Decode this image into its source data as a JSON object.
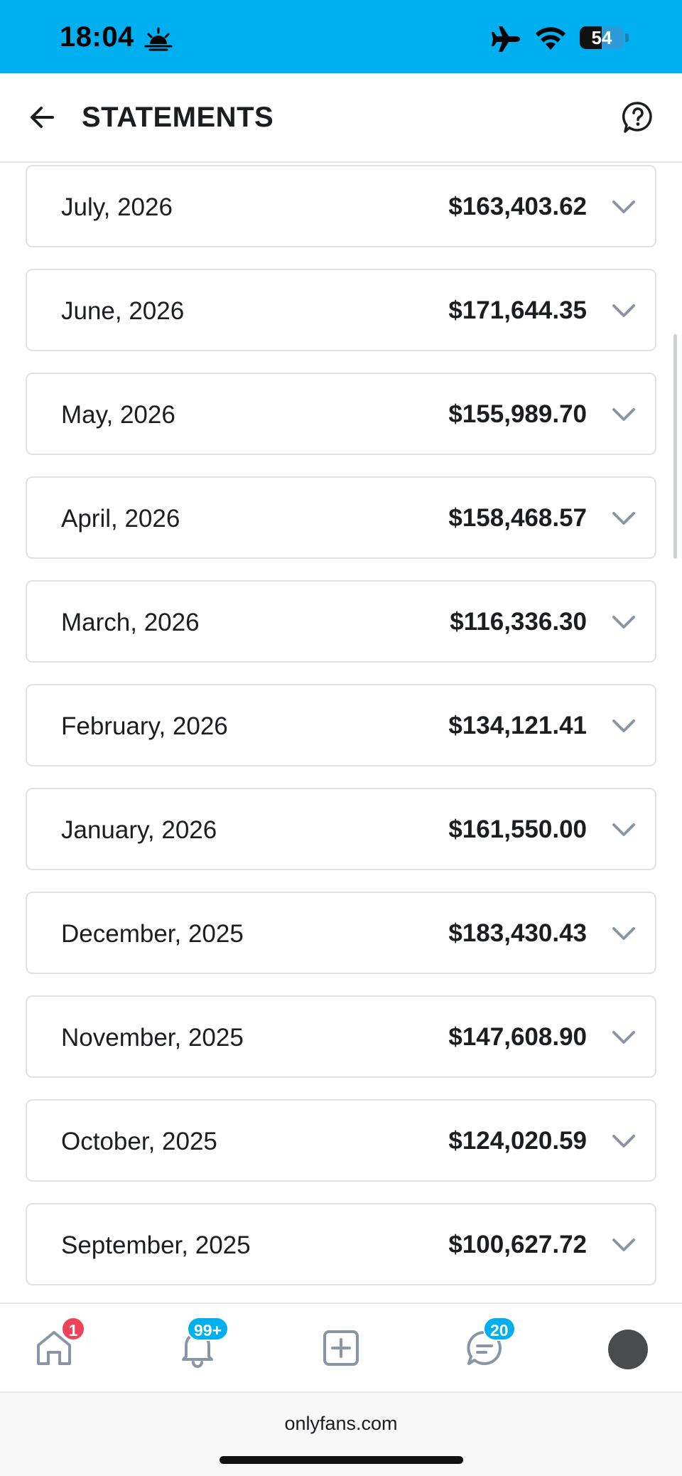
{
  "status_bar": {
    "time": "18:04",
    "battery_level": "54",
    "icons": [
      "sunrise-icon",
      "airplane-mode-icon",
      "wifi-icon",
      "battery-icon"
    ]
  },
  "header": {
    "title": "STATEMENTS",
    "back_icon": "arrow-left-icon",
    "help_icon": "help-icon"
  },
  "statements": [
    {
      "month": "July, 2026",
      "amount": "$163,403.62"
    },
    {
      "month": "June, 2026",
      "amount": "$171,644.35"
    },
    {
      "month": "May, 2026",
      "amount": "$155,989.70"
    },
    {
      "month": "April, 2026",
      "amount": "$158,468.57"
    },
    {
      "month": "March, 2026",
      "amount": "$116,336.30"
    },
    {
      "month": "February, 2026",
      "amount": "$134,121.41"
    },
    {
      "month": "January, 2026",
      "amount": "$161,550.00"
    },
    {
      "month": "December, 2025",
      "amount": "$183,430.43"
    },
    {
      "month": "November, 2025",
      "amount": "$147,608.90"
    },
    {
      "month": "October, 2025",
      "amount": "$124,020.59"
    },
    {
      "month": "September, 2025",
      "amount": "$100,627.72"
    }
  ],
  "bottom_nav": {
    "home_badge": "1",
    "notifications_badge": "99+",
    "messages_badge": "20",
    "icons": [
      "home-icon",
      "bell-icon",
      "add-post-icon",
      "messages-icon",
      "avatar"
    ]
  },
  "browser": {
    "url": "onlyfans.com"
  },
  "colors": {
    "brand": "#00aff0",
    "home_badge": "#f0435b",
    "count_badge": "#00aff0",
    "text": "#1b1d1f",
    "muted_icon": "#8a96a3"
  }
}
